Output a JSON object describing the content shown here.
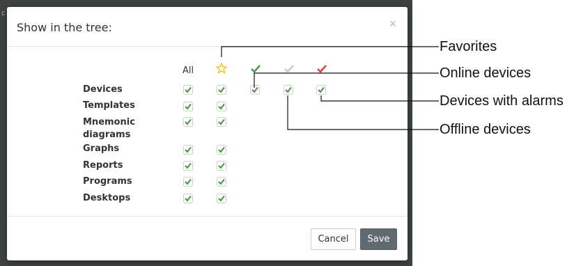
{
  "dialog": {
    "title": "Show in the tree:",
    "close_glyph": "×",
    "columns": {
      "all_label": "All",
      "favorites_icon": "star-outline-icon",
      "online_icon": "check-green-icon",
      "offline_icon": "check-gray-icon",
      "alarms_icon": "check-red-icon"
    },
    "rows": [
      {
        "label": "Devices"
      },
      {
        "label": "Templates"
      },
      {
        "label": "Mnemonic diagrams"
      },
      {
        "label": "Graphs"
      },
      {
        "label": "Reports"
      },
      {
        "label": "Programs"
      },
      {
        "label": "Desktops"
      }
    ],
    "buttons": {
      "cancel": "Cancel",
      "save": "Save"
    }
  },
  "annotations": {
    "favorites": "Favorites",
    "online": "Online devices",
    "alarms": "Devices with alarms",
    "offline": "Offline devices"
  },
  "colors": {
    "check_green": "#4a9a4a",
    "check_gray": "#c8c8c8",
    "check_red": "#d9433a",
    "star_yellow": "#f0c21b",
    "checkbox_border": "#cfcfcf"
  }
}
